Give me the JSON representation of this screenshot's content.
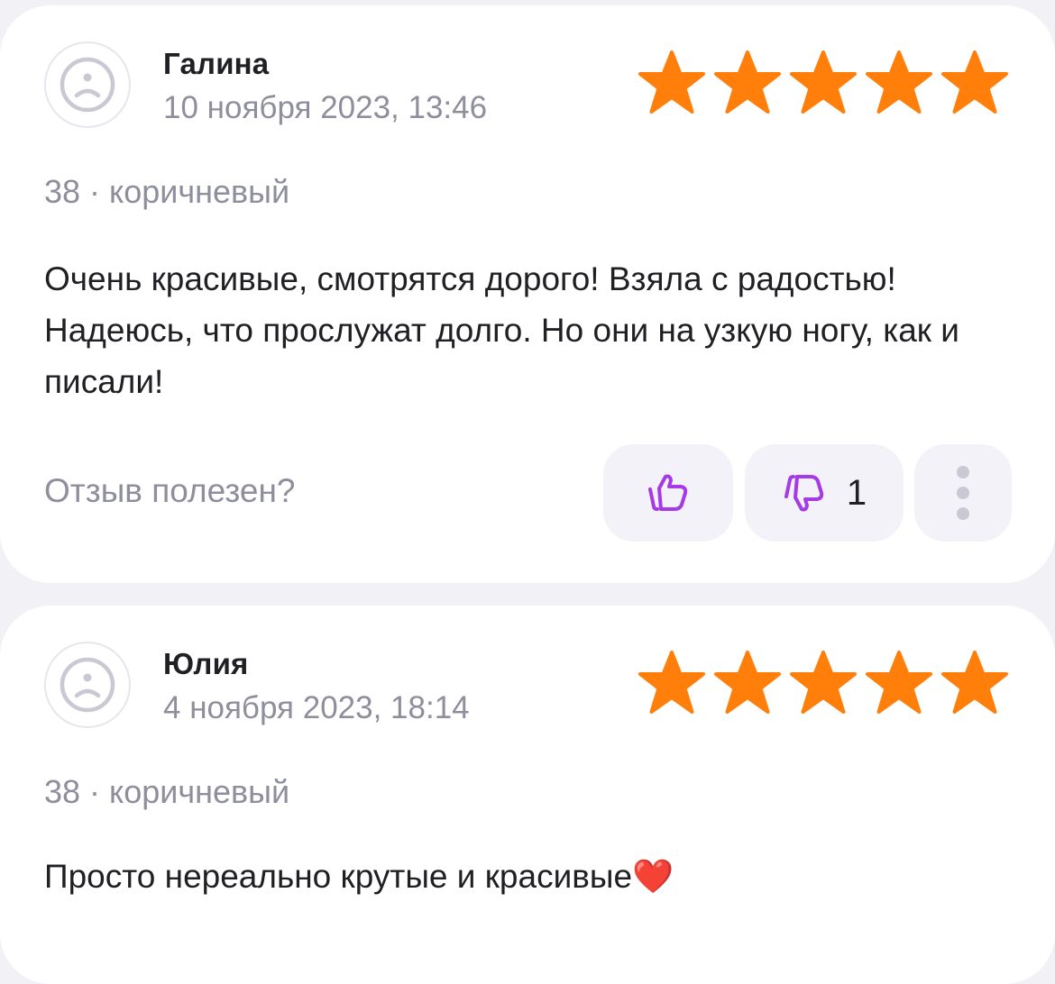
{
  "reviews": [
    {
      "author": "Галина",
      "date": "10 ноября 2023, 13:46",
      "rating": 5,
      "variant": "38 · коричневый",
      "text": "Очень красивые, смотрятся дорого! Взяла с радостью! Надеюсь, что прослужат долго. Но они на узкую ногу, как и писали!",
      "helpful_label": "Отзыв полезен?",
      "dislikes": "1"
    },
    {
      "author": "Юлия",
      "date": "4 ноября 2023, 18:14",
      "rating": 5,
      "variant": "38 · коричневый",
      "text": "Просто нереально крутые и красивые❤️"
    }
  ],
  "icons": {
    "avatar": "sad-face-icon",
    "star": "star-icon",
    "like": "thumbs-up-icon",
    "dislike": "thumbs-down-icon",
    "more": "more-vertical-icon"
  },
  "colors": {
    "star": "#ff7f0a",
    "vote_icon": "#a63ae6",
    "muted_text": "#8e8e9c",
    "button_bg": "#f3f2f8"
  }
}
